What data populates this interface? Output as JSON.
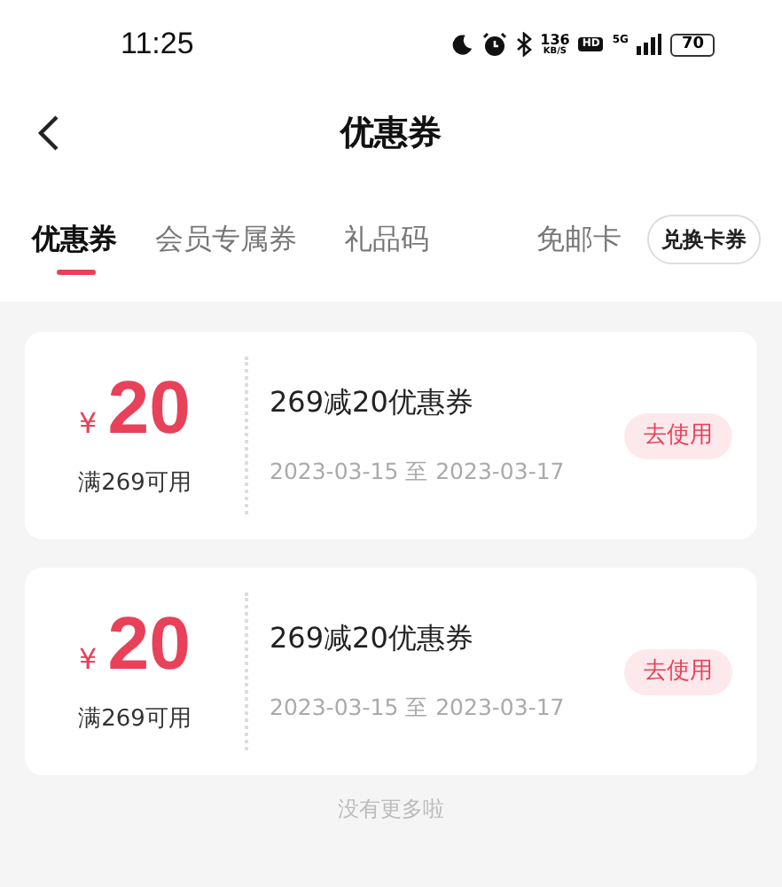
{
  "status_bar": {
    "time": "11:25",
    "net_speed": "136",
    "net_unit": "KB/S",
    "hd": "HD",
    "network": "5G",
    "battery": "70"
  },
  "header": {
    "title": "优惠券"
  },
  "tabs": [
    {
      "label": "优惠券",
      "selected": true
    },
    {
      "label": "会员专属券",
      "selected": false
    },
    {
      "label": "礼品码",
      "selected": false
    },
    {
      "label": "免邮卡",
      "selected": false
    }
  ],
  "exchange_button": "兑换卡券",
  "coupons": [
    {
      "currency": "¥",
      "amount": "20",
      "condition": "满269可用",
      "title": "269减20优惠券",
      "validity": "2023-03-15 至 2023-03-17",
      "action": "去使用"
    },
    {
      "currency": "¥",
      "amount": "20",
      "condition": "满269可用",
      "title": "269减20优惠券",
      "validity": "2023-03-15 至 2023-03-17",
      "action": "去使用"
    }
  ],
  "footer": "没有更多啦"
}
